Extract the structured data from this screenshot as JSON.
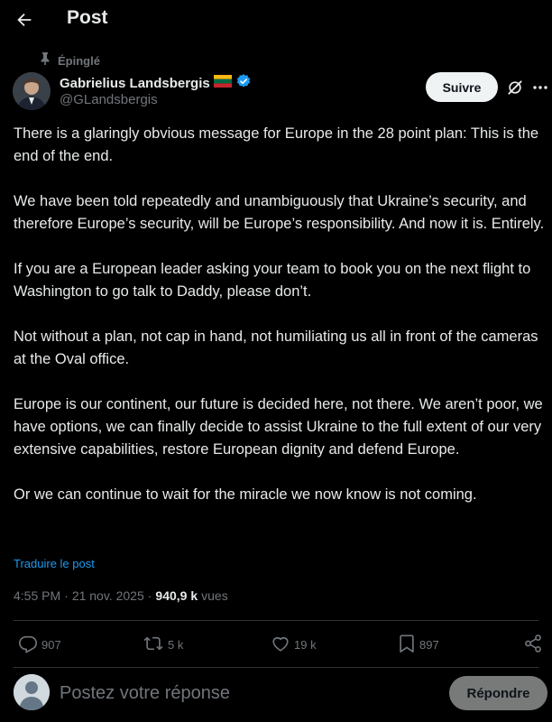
{
  "header": {
    "title": "Post"
  },
  "post": {
    "pinned_label": "Épinglé",
    "author": {
      "display_name": "Gabrielius Landsbergis",
      "handle": "@GLandsbergis",
      "verified": true,
      "flag": "lithuania"
    },
    "follow_label": "Suivre",
    "paragraphs": [
      "There is a glaringly obvious message for Europe in the 28 point plan: This is the end of the end.",
      "We have been told repeatedly and unambiguously that Ukraine’s security, and therefore Europe’s security, will be Europe’s responsibility. And now it is. Entirely.",
      "If you are a European leader asking your team to book you on the next flight to Washington to go talk to Daddy, please don’t.",
      "Not without a plan, not cap in hand, not humiliating us all in front of the cameras at the Oval office.",
      "Europe is our continent, our future is decided here, not there. We aren’t poor, we have options, we can finally decide to assist Ukraine to the full extent of our very extensive capabilities, restore European dignity and defend Europe.",
      "Or we can continue to wait for the miracle we now know is not coming."
    ],
    "translate_label": "Traduire le post",
    "time": "4:55 PM",
    "date": "21 nov. 2025",
    "separator": "·",
    "views_count": "940,9 k",
    "views_label": "vues"
  },
  "actions": {
    "replies": "907",
    "reposts": "5 k",
    "likes": "19 k",
    "bookmarks": "897"
  },
  "reply_bar": {
    "placeholder": "Postez votre réponse",
    "button_label": "Répondre"
  },
  "colors": {
    "background": "#000000",
    "text": "#e7e9ea",
    "secondary": "#71767b",
    "accent": "#1d9bf0",
    "verified": "#1d9bf0"
  }
}
